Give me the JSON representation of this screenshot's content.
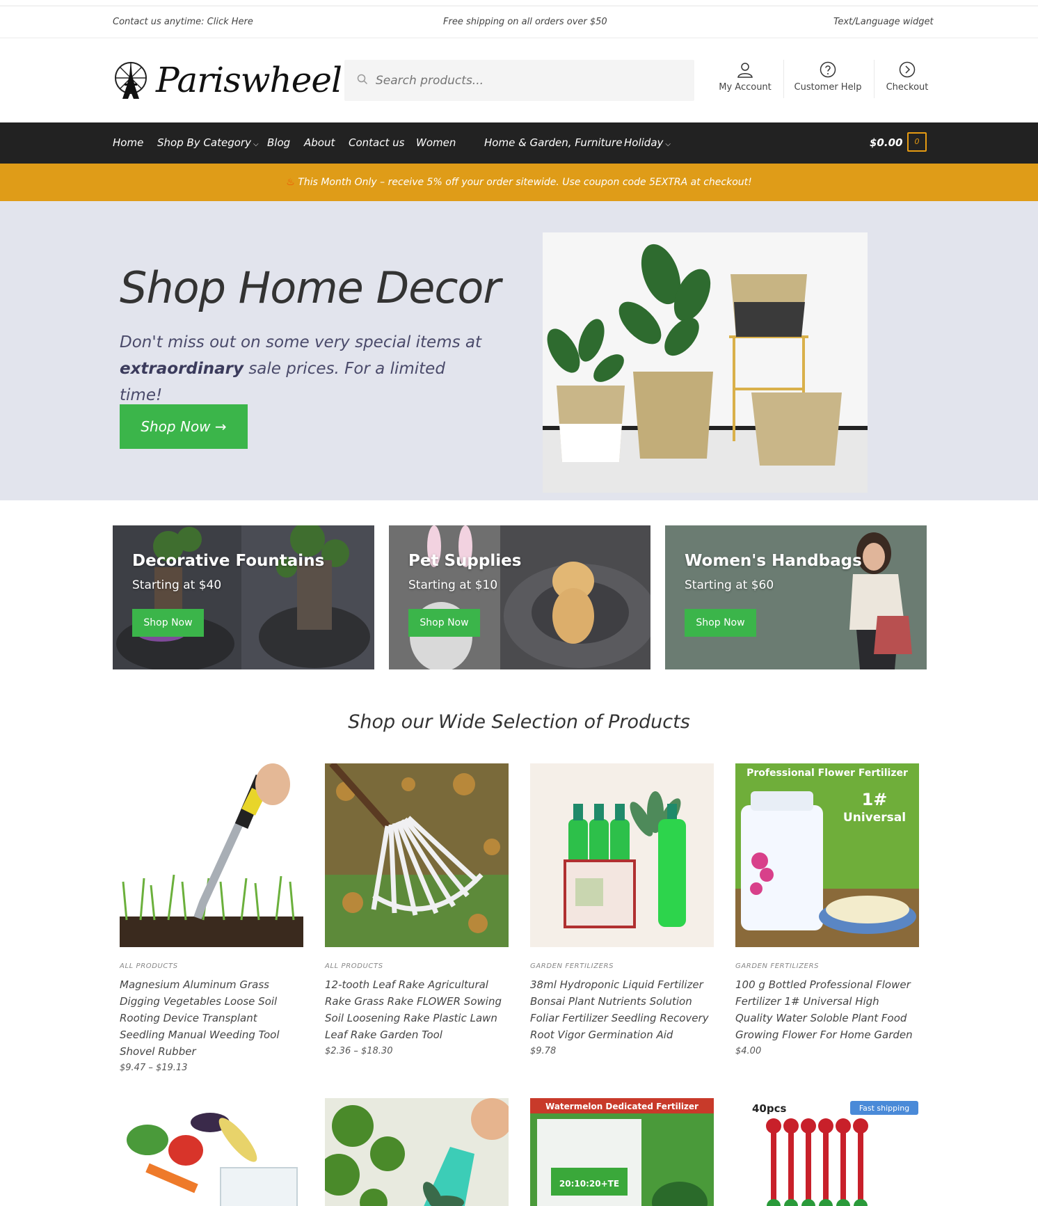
{
  "topbar": {
    "contact": "Contact us anytime: Click Here",
    "shipping": "Free shipping on all orders over $50",
    "language": "Text/Language widget"
  },
  "header": {
    "logo_text": "Pariswheel",
    "search_placeholder": "Search products...",
    "links": {
      "account": "My Account",
      "help": "Customer Help",
      "checkout": "Checkout"
    }
  },
  "nav": {
    "items": [
      "Home",
      "Shop By Category",
      "Blog",
      "About",
      "Contact us",
      "Women",
      "Home & Garden, Furniture",
      "Holiday"
    ],
    "cart_total": "$0.00",
    "cart_count": "0"
  },
  "promo_bar": {
    "text": "This Month Only – receive 5% off your order sitewide. Use coupon code 5EXTRA at checkout!"
  },
  "hero": {
    "title": "Shop Home Decor",
    "text_before": "Don't miss out on some very special items at ",
    "text_bold": "extraordinary",
    "text_after": " sale prices. For a limited time!",
    "button": "Shop Now →"
  },
  "promos": [
    {
      "title": "Decorative Fountains",
      "sub": "Starting at $40",
      "button": "Shop Now"
    },
    {
      "title": "Pet Supplies",
      "sub": "Starting at $10",
      "button": "Shop Now"
    },
    {
      "title": "Women's Handbags",
      "sub": "Starting at $60",
      "button": "Shop Now"
    }
  ],
  "products_section": {
    "title": "Shop our Wide Selection of Products"
  },
  "products": [
    {
      "category": "ALL PRODUCTS",
      "name": "Magnesium Aluminum Grass Digging Vegetables Loose Soil Rooting Device Transplant Seedling Manual Weeding Tool Shovel Rubber",
      "price": "$9.47 – $19.13"
    },
    {
      "category": "ALL PRODUCTS",
      "name": "12-tooth Leaf Rake Agricultural Rake Grass Rake FLOWER Sowing Soil Loosening Rake Plastic Lawn Leaf Rake Garden Tool",
      "price": "$2.36 – $18.30"
    },
    {
      "category": "GARDEN FERTILIZERS",
      "name": "38ml Hydroponic Liquid Fertilizer Bonsai Plant Nutrients Solution Foliar Fertilizer Seedling Recovery Root Vigor Germination Aid",
      "price": "$9.78"
    },
    {
      "category": "GARDEN FERTILIZERS",
      "name": "100 g Bottled Professional Flower Fertilizer 1# Universal High Quality Water Soloble Plant Food Growing Flower For Home Garden",
      "price": "$4.00"
    }
  ],
  "product_image_text": {
    "fertilizer_banner": "Professional Flower Fertilizer",
    "fertilizer_num": "1#",
    "fertilizer_universal": "Universal",
    "watermelon_banner": "Watermelon Dedicated Fertilizer",
    "watermelon_label": "20:10:20+TE",
    "trimmer_count": "40pcs",
    "trimmer_badge": "Fast shipping"
  },
  "colors": {
    "nav_bg": "#222222",
    "promo_bar": "#df9c18",
    "accent_green": "#3bb54a",
    "hero_bg": "#e2e4ed",
    "cart_accent": "#e69b12"
  }
}
